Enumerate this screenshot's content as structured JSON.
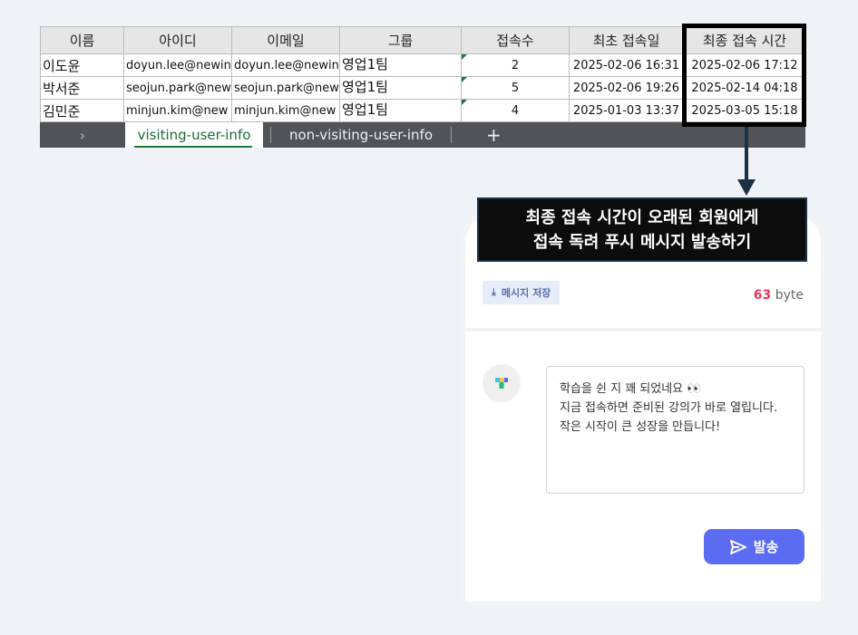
{
  "sheet": {
    "headers": [
      "이름",
      "아이디",
      "이메일",
      "그룹",
      "접속수",
      "최초 접속일",
      "최종 접속 시간"
    ],
    "rows": [
      {
        "name": "이도윤",
        "id": "doyun.lee@newin",
        "email": "doyun.lee@newin",
        "group": "영업1팀",
        "visits": "2",
        "first": "2025-02-06 16:31",
        "last": "2025-02-06 17:12"
      },
      {
        "name": "박서준",
        "id": "seojun.park@new",
        "email": "seojun.park@new",
        "group": "영업1팀",
        "visits": "5",
        "first": "2025-02-06 19:26",
        "last": "2025-02-14 04:18"
      },
      {
        "name": "김민준",
        "id": "minjun.kim@new",
        "email": "minjun.kim@new",
        "group": "영업1팀",
        "visits": "4",
        "first": "2025-01-03 13:37",
        "last": "2025-03-05 15:18"
      }
    ],
    "tabs": {
      "nav": "›",
      "active": "visiting-user-info",
      "other": "non-visiting-user-info",
      "add": "+"
    }
  },
  "callout": {
    "line1": "최종 접속 시간이 오래된 회원에게",
    "line2": "접속 독려 푸시 메시지 발송하기"
  },
  "composer": {
    "save_label": "메시지 저장",
    "byte_count": "63",
    "byte_unit": "byte",
    "message": [
      "학습을 쉰 지 꽤 되었네요 👀",
      "지금 접속하면 준비된 강의가 바로 열립니다.",
      "작은 시작이 큰 성장을 만듭니다!"
    ],
    "send_label": "발송"
  },
  "colors": {
    "accent": "#5b6cf2",
    "byte_count": "#e5365a",
    "sheet_green": "#1e7a3c",
    "tab_bar": "#505357"
  }
}
